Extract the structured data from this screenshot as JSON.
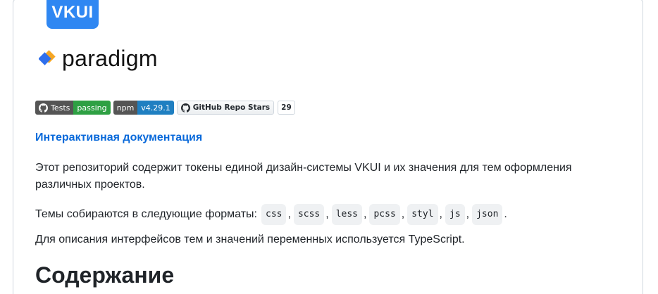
{
  "logos": {
    "vkui_text": "VKUI",
    "paradigm_text": "paradigm"
  },
  "badges": {
    "tests": {
      "label": "Tests",
      "value": "passing"
    },
    "npm": {
      "label": "npm",
      "value": "v4.29.1"
    },
    "stars": {
      "label": "GitHub Repo Stars",
      "value": "29"
    }
  },
  "docs_link": "Интерактивная документация",
  "intro": "Этот репозиторий содержит токены единой дизайн-системы VKUI и их значения для тем оформления различных проектов.",
  "formats": {
    "prefix": "Темы собираются в следующие форматы:",
    "items": [
      "css",
      "scss",
      "less",
      "pcss",
      "styl",
      "js",
      "json"
    ],
    "suffix": "."
  },
  "typescript_note": "Для описания интерфейсов тем и значений переменных используется TypeScript.",
  "heading": "Содержание",
  "colors": {
    "link": "#0969da",
    "vkui_blue": "#2f87f2",
    "badge_green": "#2ea043",
    "badge_blue": "#1f7fc1"
  }
}
